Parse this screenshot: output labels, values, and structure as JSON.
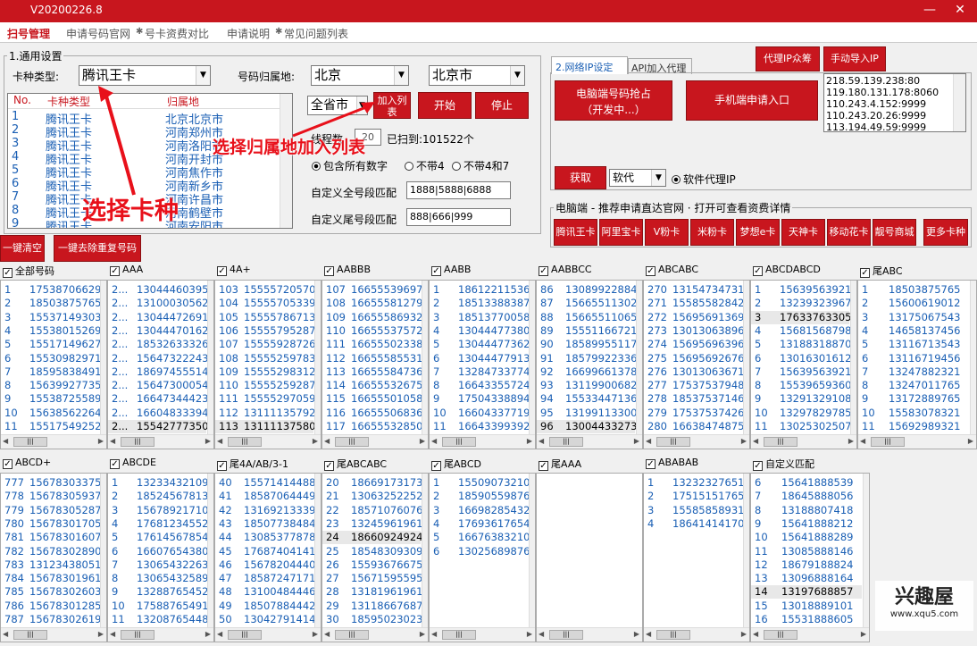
{
  "titlebar": {
    "version": "V20200226.8",
    "minimize": "—",
    "close": "✕"
  },
  "tabs": [
    "扫号管理",
    "申请号码官网",
    "号卡资费对比",
    "申请说明",
    "常见问题列表"
  ],
  "general": {
    "legend": "1.通用设置",
    "card_type_label": "卡种类型:",
    "card_type_value": "腾讯王卡",
    "region_label": "号码归属地:",
    "province_value": "北京",
    "city_value": "北京市",
    "table_headers": [
      "No.",
      "卡种类型",
      "归属地"
    ],
    "table_rows": [
      [
        "1",
        "腾讯王卡",
        "北京北京市"
      ],
      [
        "2",
        "腾讯王卡",
        "河南郑州市"
      ],
      [
        "3",
        "腾讯王卡",
        "河南洛阳市"
      ],
      [
        "4",
        "腾讯王卡",
        "河南开封市"
      ],
      [
        "5",
        "腾讯王卡",
        "河南焦作市"
      ],
      [
        "6",
        "腾讯王卡",
        "河南新乡市"
      ],
      [
        "7",
        "腾讯王卡",
        "河南许昌市"
      ],
      [
        "8",
        "腾讯王卡",
        "河南鹤壁市"
      ],
      [
        "9",
        "腾讯王卡",
        "河南安阳市"
      ]
    ],
    "all_city_value": "全省市",
    "add_list_label": "加入列表",
    "start_label": "开始",
    "stop_label": "停止",
    "threads_label": "线程数",
    "threads_value": "20",
    "scanned_text": "已扫到:101522个",
    "radio_all": "包含所有数字",
    "radio_no4": "不带4",
    "radio_no47": "不带4和7",
    "custom_full_label": "自定义全号段匹配",
    "custom_full_value": "1888|5888|6888",
    "custom_tail_label": "自定义尾号段匹配",
    "custom_tail_value": "888|666|999"
  },
  "network": {
    "tab_ip": "2.网络IP设定",
    "tab_api": "API加入代理",
    "btn_pc_grab_line1": "电脑端号码抢占",
    "btn_pc_grab_line2": "（开发中...）",
    "btn_phone_apply": "手机端申请入口",
    "btn_proxy_crowd": "代理IP众筹",
    "btn_manual_import": "手动导入IP",
    "ip_list": [
      "218.59.139.238:80",
      "119.180.131.178:8060",
      "110.243.4.152:9999",
      "110.243.20.26:9999",
      "113.194.49.59:9999"
    ],
    "btn_fetch": "获取",
    "proxy_type_value": "软代",
    "radio_soft_proxy": "软件代理IP"
  },
  "recommend": {
    "title": "电脑端 - 推荐申请直达官网 · 打开可查看资费详情",
    "buttons": [
      "腾讯王卡",
      "阿里宝卡",
      "V粉卡",
      "米粉卡",
      "梦想e卡",
      "天神卡",
      "移动花卡",
      "靓号商城",
      "更多卡种"
    ]
  },
  "actions": {
    "clear_all": "一键清空",
    "dedupe": "一键去除重复号码"
  },
  "sections_top": [
    {
      "title": "全部号码",
      "rows": [
        [
          "1",
          "17538706629"
        ],
        [
          "2",
          "18503875765"
        ],
        [
          "3",
          "15537149303"
        ],
        [
          "4",
          "15538015269"
        ],
        [
          "5",
          "15517149627"
        ],
        [
          "6",
          "15530982971"
        ],
        [
          "7",
          "18595838491"
        ],
        [
          "8",
          "15639927735"
        ],
        [
          "9",
          "15538725589"
        ],
        [
          "10",
          "15638562264"
        ],
        [
          "11",
          "15517549252"
        ]
      ]
    },
    {
      "title": "AAA",
      "rows": [
        [
          "2...",
          "13044460395"
        ],
        [
          "2...",
          "13100030562"
        ],
        [
          "2...",
          "13044472691"
        ],
        [
          "2...",
          "13044470162"
        ],
        [
          "2...",
          "18532633326"
        ],
        [
          "2...",
          "15647322243"
        ],
        [
          "2...",
          "18697455514"
        ],
        [
          "2...",
          "15647300054"
        ],
        [
          "2...",
          "16647344423"
        ],
        [
          "2...",
          "16604833394"
        ],
        [
          "2...",
          "15542777350"
        ]
      ],
      "selected": 10
    },
    {
      "title": "4A+",
      "rows": [
        [
          "103",
          "15555720570"
        ],
        [
          "104",
          "15555705339"
        ],
        [
          "105",
          "15555786713"
        ],
        [
          "106",
          "15555795287"
        ],
        [
          "107",
          "15555928726"
        ],
        [
          "108",
          "15555259783"
        ],
        [
          "109",
          "15555298312"
        ],
        [
          "110",
          "15555259287"
        ],
        [
          "111",
          "15555297059"
        ],
        [
          "112",
          "13111135792"
        ],
        [
          "113",
          "13111137580"
        ]
      ],
      "selected": 10
    },
    {
      "title": "AABBB",
      "rows": [
        [
          "107",
          "16655539697"
        ],
        [
          "108",
          "16655581279"
        ],
        [
          "109",
          "16655586932"
        ],
        [
          "110",
          "16655537572"
        ],
        [
          "111",
          "16655502338"
        ],
        [
          "112",
          "16655585531"
        ],
        [
          "113",
          "16655584736"
        ],
        [
          "114",
          "16655532675"
        ],
        [
          "115",
          "16655501058"
        ],
        [
          "116",
          "16655506836"
        ],
        [
          "117",
          "16655532850"
        ]
      ]
    },
    {
      "title": "AABB",
      "rows": [
        [
          "1",
          "18612211536"
        ],
        [
          "2",
          "18513388387"
        ],
        [
          "3",
          "18513770058"
        ],
        [
          "4",
          "13044477380"
        ],
        [
          "5",
          "13044477362"
        ],
        [
          "6",
          "13044477913"
        ],
        [
          "7",
          "13284733774"
        ],
        [
          "8",
          "16643355724"
        ],
        [
          "9",
          "17504338894"
        ],
        [
          "10",
          "16604337719"
        ],
        [
          "11",
          "16643399392"
        ]
      ]
    },
    {
      "title": "AABBCC",
      "rows": [
        [
          "86",
          "13089922884"
        ],
        [
          "87",
          "15665511302"
        ],
        [
          "88",
          "15665511065"
        ],
        [
          "89",
          "15551166721"
        ],
        [
          "90",
          "18589955117"
        ],
        [
          "91",
          "18579922336"
        ],
        [
          "92",
          "16699661378"
        ],
        [
          "93",
          "13119900682"
        ],
        [
          "94",
          "15533447136"
        ],
        [
          "95",
          "13199113300"
        ],
        [
          "96",
          "13004433273"
        ]
      ],
      "selected": 10
    },
    {
      "title": "ABCABC",
      "rows": [
        [
          "270",
          "13154734731"
        ],
        [
          "271",
          "15585582842"
        ],
        [
          "272",
          "15695691369"
        ],
        [
          "273",
          "13013063896"
        ],
        [
          "274",
          "15695696396"
        ],
        [
          "275",
          "15695692676"
        ],
        [
          "276",
          "13013063671"
        ],
        [
          "277",
          "17537537948"
        ],
        [
          "278",
          "18537537146"
        ],
        [
          "279",
          "17537537426"
        ],
        [
          "280",
          "16638474875"
        ]
      ]
    },
    {
      "title": "ABCDABCD",
      "rows": [
        [
          "1",
          "15639563921"
        ],
        [
          "2",
          "13239323967"
        ],
        [
          "3",
          "17633763305"
        ],
        [
          "4",
          "15681568798"
        ],
        [
          "5",
          "13188318870"
        ],
        [
          "6",
          "13016301612"
        ],
        [
          "7",
          "15639563921"
        ],
        [
          "8",
          "15539659360"
        ],
        [
          "9",
          "13291329108"
        ],
        [
          "10",
          "13297829785"
        ],
        [
          "11",
          "13025302507"
        ]
      ],
      "selected": 2
    },
    {
      "title": "尾ABC",
      "rows": [
        [
          "1",
          "18503875765"
        ],
        [
          "2",
          "15600619012"
        ],
        [
          "3",
          "13175067543"
        ],
        [
          "4",
          "14658137456"
        ],
        [
          "5",
          "13116713543"
        ],
        [
          "6",
          "13116719456"
        ],
        [
          "7",
          "13247882321"
        ],
        [
          "8",
          "13247011765"
        ],
        [
          "9",
          "13172889765"
        ],
        [
          "10",
          "15583078321"
        ],
        [
          "11",
          "15692989321"
        ]
      ]
    }
  ],
  "sections_bottom": [
    {
      "title": "ABCD+",
      "rows": [
        [
          "777",
          "15678303375"
        ],
        [
          "778",
          "15678305937"
        ],
        [
          "779",
          "15678305287"
        ],
        [
          "780",
          "15678301705"
        ],
        [
          "781",
          "15678301607"
        ],
        [
          "782",
          "15678302890"
        ],
        [
          "783",
          "13123438051"
        ],
        [
          "784",
          "15678301961"
        ],
        [
          "785",
          "15678302603"
        ],
        [
          "786",
          "15678301285"
        ],
        [
          "787",
          "15678302619"
        ]
      ]
    },
    {
      "title": "ABCDE",
      "rows": [
        [
          "1",
          "13233432109"
        ],
        [
          "2",
          "18524567813"
        ],
        [
          "3",
          "15678921710"
        ],
        [
          "4",
          "17681234552"
        ],
        [
          "5",
          "17614567854"
        ],
        [
          "6",
          "16607654380"
        ],
        [
          "7",
          "13065432263"
        ],
        [
          "8",
          "13065432589"
        ],
        [
          "9",
          "13288765452"
        ],
        [
          "10",
          "17588765491"
        ],
        [
          "11",
          "13208765448"
        ]
      ]
    },
    {
      "title": "尾4A/AB/3-1",
      "rows": [
        [
          "40",
          "15571414488"
        ],
        [
          "41",
          "18587064449"
        ],
        [
          "42",
          "13169213339"
        ],
        [
          "43",
          "18507738484"
        ],
        [
          "44",
          "13085377878"
        ],
        [
          "45",
          "17687404141"
        ],
        [
          "46",
          "15678204440"
        ],
        [
          "47",
          "18587247171"
        ],
        [
          "48",
          "13100484446"
        ],
        [
          "49",
          "18507884442"
        ],
        [
          "50",
          "13042791414"
        ]
      ]
    },
    {
      "title": "尾ABCABC",
      "rows": [
        [
          "20",
          "18669173173"
        ],
        [
          "21",
          "13063252252"
        ],
        [
          "22",
          "18571076076"
        ],
        [
          "23",
          "13245961961"
        ],
        [
          "24",
          "18660924924"
        ],
        [
          "25",
          "18548309309"
        ],
        [
          "26",
          "15593676675"
        ],
        [
          "27",
          "15671595595"
        ],
        [
          "28",
          "13181961961"
        ],
        [
          "29",
          "13118667687"
        ],
        [
          "30",
          "18595023023"
        ]
      ],
      "selected": 4
    },
    {
      "title": "尾ABCD",
      "rows": [
        [
          "1",
          "15509073210"
        ],
        [
          "2",
          "18590559876"
        ],
        [
          "3",
          "16698285432"
        ],
        [
          "4",
          "17693617654"
        ],
        [
          "5",
          "16676383210"
        ],
        [
          "6",
          "13025689876"
        ]
      ]
    },
    {
      "title": "尾AAA",
      "rows": []
    },
    {
      "title": "ABABAB",
      "rows": [
        [
          "1",
          "13232327651"
        ],
        [
          "2",
          "17515151765"
        ],
        [
          "3",
          "15585858931"
        ],
        [
          "4",
          "18641414170"
        ]
      ]
    },
    {
      "title": "自定义匹配",
      "rows": [
        [
          "6",
          "15641888539"
        ],
        [
          "7",
          "18645888056"
        ],
        [
          "8",
          "13188807418"
        ],
        [
          "9",
          "15641888212"
        ],
        [
          "10",
          "15641888289"
        ],
        [
          "11",
          "13085888146"
        ],
        [
          "12",
          "18679188824"
        ],
        [
          "13",
          "13096888164"
        ],
        [
          "14",
          "13197688857"
        ],
        [
          "15",
          "13018889101"
        ],
        [
          "16",
          "15531888605"
        ]
      ],
      "selected": 8
    }
  ],
  "annotations": {
    "select_card": "选择卡种",
    "select_region": "选择归属地加入列表"
  },
  "watermark": {
    "brand": "兴趣屋",
    "url": "www.xqu5.com"
  }
}
